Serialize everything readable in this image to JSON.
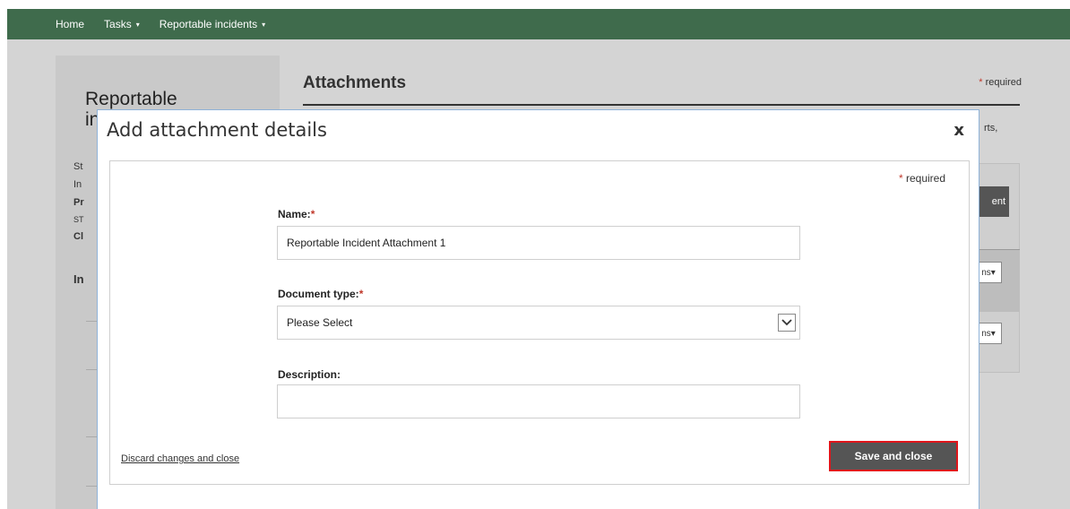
{
  "nav": {
    "home": "Home",
    "tasks": "Tasks",
    "reportable_incidents": "Reportable incidents",
    "caret": "▾"
  },
  "background": {
    "left_title_line1": "Reportable",
    "left_title_line2": "in",
    "left_rows": [
      "St",
      "In",
      "Pr",
      "ST",
      "Cl"
    ],
    "left_section": "In",
    "main_title": "Attachments",
    "required_label": "required",
    "right_snippet": "rts,",
    "right_button": "ent",
    "actions_snippet": "ns▾"
  },
  "modal": {
    "title": "Add attachment details",
    "close": "x",
    "required_label": "required",
    "star": "*",
    "name_label": "Name:",
    "name_value": "Reportable Incident Attachment 1",
    "doc_type_label": "Document type:",
    "doc_type_value": "Please Select",
    "description_label": "Description:",
    "description_value": "",
    "discard_label": "Discard changes and close",
    "save_label": "Save and close"
  },
  "colors": {
    "nav_bg": "#3f6b4c",
    "required_star": "#c0392b",
    "save_bg": "#555555",
    "save_highlight": "#e0161b"
  }
}
